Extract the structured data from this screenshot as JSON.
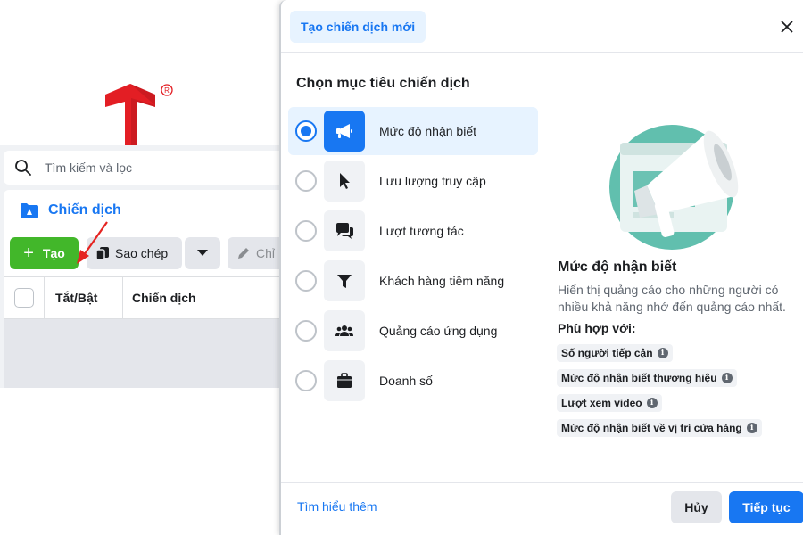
{
  "background": {
    "search": {
      "placeholder": "Tìm kiếm và lọc"
    },
    "tab": {
      "label": "Chiến dịch"
    },
    "toolbar": {
      "create_label": "Tạo",
      "create_plus": "+",
      "copy_label": "Sao chép",
      "edit_label": "Chỉ"
    },
    "table": {
      "columns": [
        "Tắt/Bật",
        "Chiến dịch"
      ]
    },
    "colors": {
      "accent": "#1877f2",
      "create_green": "#42b72a",
      "logo_red": "#e31e24",
      "arrow_red": "#e52421"
    }
  },
  "modal": {
    "title": "Tạo chiến dịch mới",
    "section_title": "Chọn mục tiêu chiến dịch",
    "options": [
      {
        "label": "Mức độ nhận biết",
        "icon": "megaphone-icon",
        "selected": true
      },
      {
        "label": "Lưu lượng truy cập",
        "icon": "cursor-icon",
        "selected": false
      },
      {
        "label": "Lượt tương tác",
        "icon": "chat-bubbles-icon",
        "selected": false
      },
      {
        "label": "Khách hàng tiềm năng",
        "icon": "filter-icon",
        "selected": false
      },
      {
        "label": "Quảng cáo ứng dụng",
        "icon": "people-icon",
        "selected": false
      },
      {
        "label": "Doanh số",
        "icon": "briefcase-icon",
        "selected": false
      }
    ],
    "detail": {
      "title": "Mức độ nhận biết",
      "description": "Hiển thị quảng cáo cho những người có nhiều khả năng nhớ đến quảng cáo nhất.",
      "fit_label": "Phù hợp với:",
      "chips": [
        "Số người tiếp cận",
        "Mức độ nhận biết thương hiệu",
        "Lượt xem video",
        "Mức độ nhận biết về vị trí cửa hàng"
      ]
    },
    "footer": {
      "learn_more": "Tìm hiểu thêm",
      "cancel": "Hủy",
      "continue": "Tiếp tục"
    }
  }
}
